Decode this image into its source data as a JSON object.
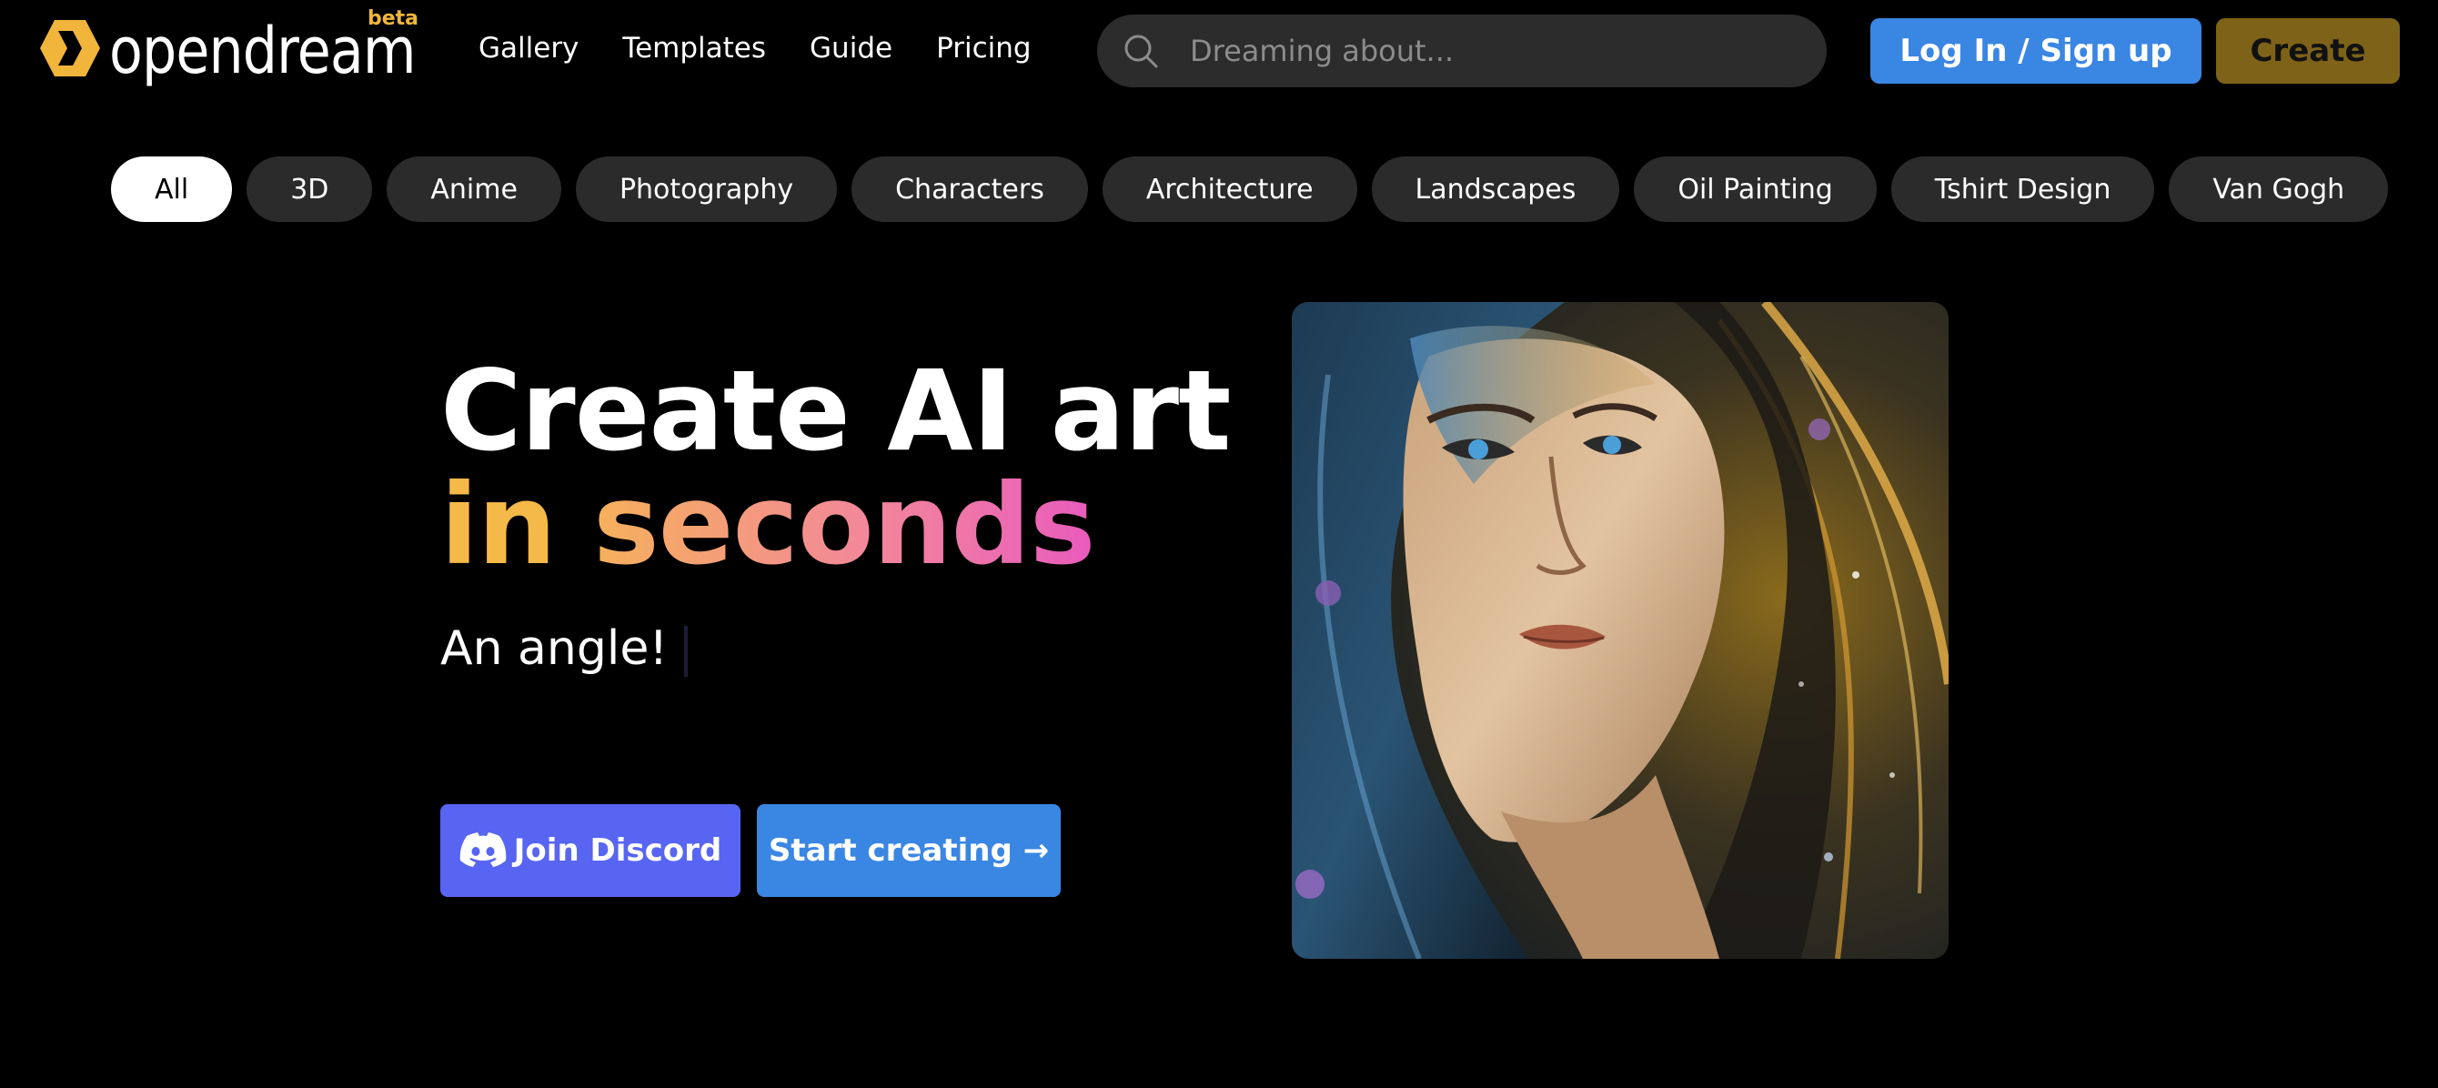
{
  "header": {
    "logo_text": "opendream",
    "logo_badge": "beta",
    "nav": [
      "Gallery",
      "Templates",
      "Guide",
      "Pricing"
    ],
    "search_placeholder": "Dreaming about...",
    "login_label": "Log In / Sign up",
    "create_label": "Create"
  },
  "categories": {
    "items": [
      "All",
      "3D",
      "Anime",
      "Photography",
      "Characters",
      "Architecture",
      "Landscapes",
      "Oil Painting",
      "Tshirt Design",
      "Van Gogh"
    ],
    "active": "All"
  },
  "hero": {
    "title_line1": "Create AI art",
    "title_line2_a": "in",
    "title_line2_b": "seconds",
    "typing_text": "An angle!",
    "discord_label": "Join Discord",
    "start_label": "Start creating →"
  },
  "colors": {
    "accent_blue": "#3a86e3",
    "discord": "#5865f2",
    "create_gold": "#7d6218",
    "logo_gold": "#f1b53b",
    "pill_bg": "#2b2b2b"
  },
  "icons": [
    "opendream-logo-icon",
    "search-icon",
    "discord-icon"
  ]
}
